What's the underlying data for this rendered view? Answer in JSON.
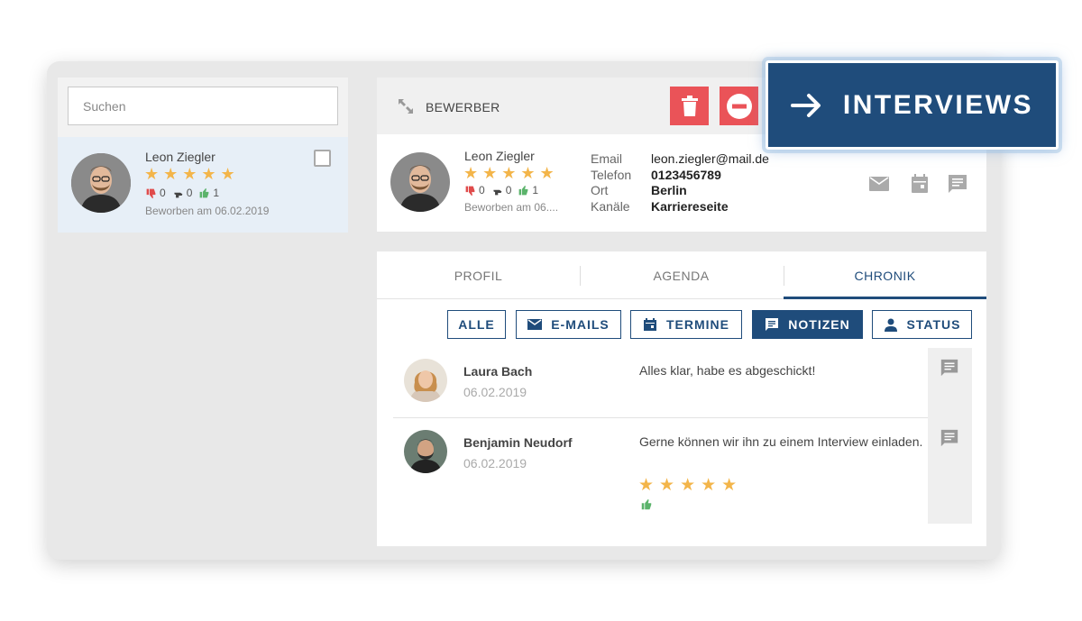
{
  "search": {
    "placeholder": "Suchen"
  },
  "candidate": {
    "name": "Leon Ziegler",
    "stars": "★★★★★",
    "votes": {
      "down": "0",
      "neutral": "0",
      "up": "1"
    },
    "applied": "Beworben am 06.02.2019",
    "applied_truncated": "Beworben am 06...."
  },
  "header": {
    "title": "BEWERBER"
  },
  "details": {
    "labels": [
      "Email",
      "Telefon",
      "Ort",
      "Kanäle"
    ],
    "values": [
      "leon.ziegler@mail.de",
      "0123456789",
      "Berlin",
      "Karriereseite"
    ]
  },
  "tabs": [
    "PROFIL",
    "AGENDA",
    "CHRONIK"
  ],
  "filters": {
    "all": "ALLE",
    "emails": "E-MAILS",
    "appointments": "TERMINE",
    "notes": "NOTIZEN",
    "status": "STATUS"
  },
  "notes": [
    {
      "author": "Laura Bach",
      "date": "06.02.2019",
      "text": "Alles klar, habe es abgeschickt!"
    },
    {
      "author": "Benjamin Neudorf",
      "date": "06.02.2019",
      "text": "Gerne können wir ihn zu einem Interview einladen.",
      "stars": "★★★★★"
    }
  ],
  "callout": {
    "label": "INTERVIEWS"
  },
  "colors": {
    "primary": "#1f4c7b",
    "danger": "#ea5358",
    "star": "#f3b54a",
    "thumb_up": "#5bb36b",
    "thumb_down": "#e04b4b"
  }
}
